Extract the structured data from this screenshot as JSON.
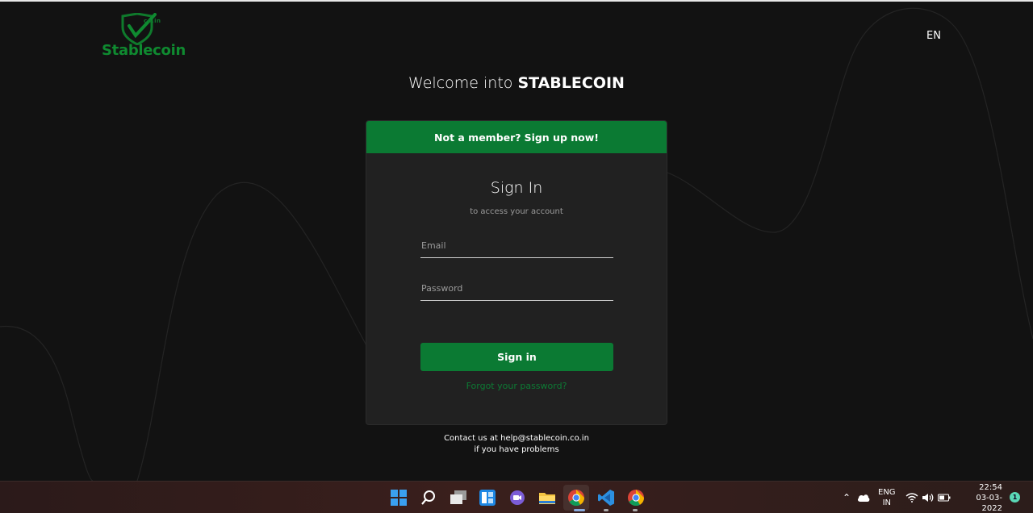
{
  "brand": {
    "name": "Stablecoin",
    "suffix": "co.in"
  },
  "language": "EN",
  "welcome": {
    "prefix": "Welcome into ",
    "brand": "STABLECOIN"
  },
  "card": {
    "banner": {
      "lead": "Not a member?",
      "link": "Sign up now!"
    },
    "title": "Sign In",
    "subtitle": "to access your account",
    "email_placeholder": "Email",
    "password_placeholder": "Password",
    "submit_label": "Sign in",
    "forgot_label": "Forgot your password?"
  },
  "contact": {
    "line1": "Contact us at help@stablecoin.co.in",
    "line2": "if you have problems"
  },
  "colors": {
    "accent": "#0b7a33",
    "background": "#121212",
    "card": "#212121"
  },
  "taskbar": {
    "apps": [
      "windows-start-icon",
      "search-icon",
      "task-view-icon",
      "widgets-icon",
      "teams-chat-icon",
      "file-explorer-icon",
      "chrome-icon",
      "vscode-icon",
      "chrome-icon"
    ],
    "tray": {
      "lang": "ENG",
      "region": "IN",
      "time": "22:54",
      "date": "03-03-2022",
      "notification_count": "1"
    }
  }
}
